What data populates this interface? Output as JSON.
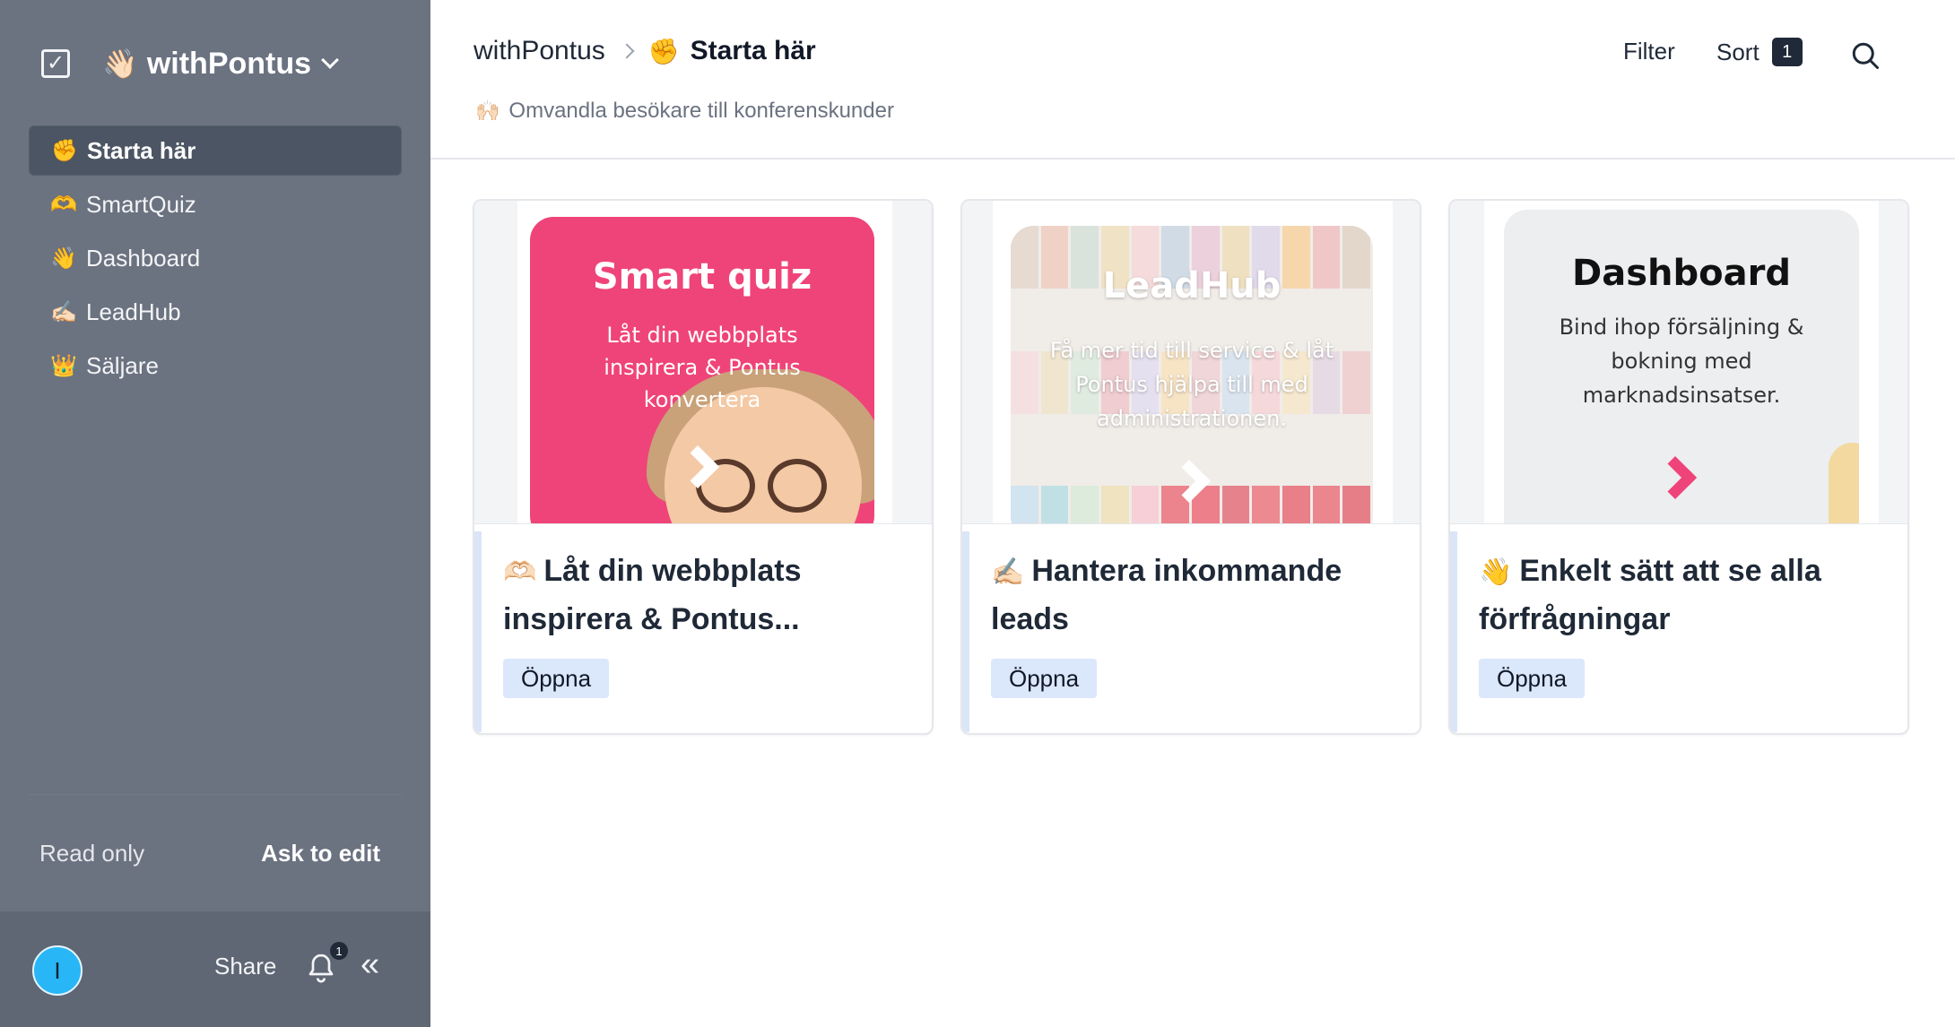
{
  "workspace": {
    "emoji": "👋🏻",
    "name": "withPontus"
  },
  "sidebar": {
    "items": [
      {
        "emoji": "✊",
        "label": "Starta här",
        "active": true
      },
      {
        "emoji": "🫶",
        "label": "SmartQuiz"
      },
      {
        "emoji": "👋",
        "label": "Dashboard"
      },
      {
        "emoji": "✍🏻",
        "label": "LeadHub"
      },
      {
        "emoji": "👑",
        "label": "Säljare"
      }
    ],
    "read_only": "Read only",
    "ask_to_edit": "Ask to edit",
    "footer": {
      "avatar_initial": "I",
      "share": "Share",
      "notification_count": "1"
    }
  },
  "header": {
    "breadcrumb_root": "withPontus",
    "current_emoji": "✊",
    "current_title": "Starta här",
    "subtitle_emoji": "🙌🏻",
    "subtitle": "Omvandla besökare till konferenskunder",
    "filter": "Filter",
    "sort": "Sort",
    "sort_count": "1"
  },
  "cards": [
    {
      "emoji": "🫶🏻",
      "title": "Låt din webbplats inspirera & Pontus...",
      "button": "Öppna",
      "cover": {
        "title": "Smart quiz",
        "text": "Låt din webbplats inspirera & Pontus konvertera"
      }
    },
    {
      "emoji": "✍🏻",
      "title": "Hantera inkommande leads",
      "button": "Öppna",
      "cover": {
        "title": "LeadHub",
        "text": "Få mer tid till service & låt Pontus hjälpa till med administrationen."
      }
    },
    {
      "emoji": "👋",
      "title": "Enkelt sätt att se alla förfrågningar",
      "button": "Öppna",
      "cover": {
        "title": "Dashboard",
        "text": "Bind ihop försäljning & bokning med marknadsinsatser."
      }
    }
  ],
  "colors": {
    "sidebar": "#6b7280",
    "accent_pink": "#ef4479",
    "button_bg": "#dbe7fb"
  }
}
